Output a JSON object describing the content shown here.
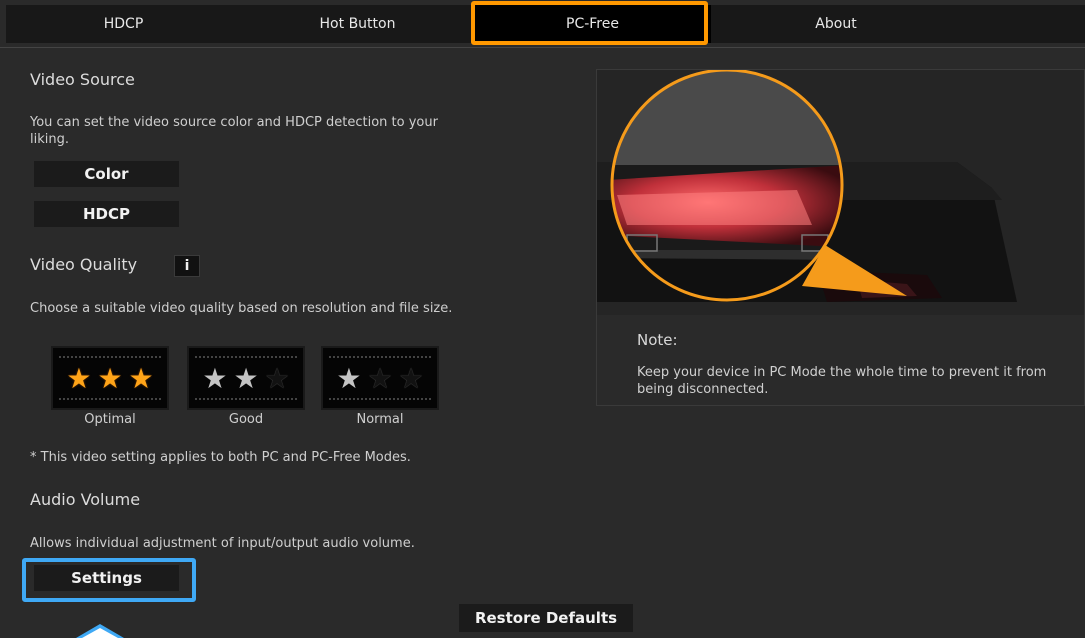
{
  "tabs": [
    {
      "label": "HDCP"
    },
    {
      "label": "Hot Button"
    },
    {
      "label": "PC-Free"
    },
    {
      "label": "About"
    }
  ],
  "active_tab": "PC-Free",
  "video_source": {
    "heading": "Video Source",
    "description": "You can set the video source color and HDCP detection to your liking.",
    "buttons": {
      "color": "Color",
      "hdcp": "HDCP"
    }
  },
  "video_quality": {
    "heading": "Video Quality",
    "info_label": "i",
    "description": "Choose a suitable video quality based on resolution and file size.",
    "options": [
      {
        "label": "Optimal",
        "stars": 3
      },
      {
        "label": "Good",
        "stars": 2
      },
      {
        "label": "Normal",
        "stars": 1
      }
    ],
    "footnote": "* This video setting applies to both PC and PC-Free Modes."
  },
  "audio_volume": {
    "heading": "Audio Volume",
    "description": "Allows individual adjustment of input/output audio volume.",
    "settings_label": "Settings"
  },
  "note": {
    "title": "Note:",
    "text": "Keep your device in PC Mode the whole time to prevent it from being disconnected."
  },
  "restore_label": "Restore Defaults",
  "colors": {
    "tab_highlight": "#ff9800",
    "button_highlight": "#3fa9f5",
    "star_gold": "#ffa418"
  }
}
